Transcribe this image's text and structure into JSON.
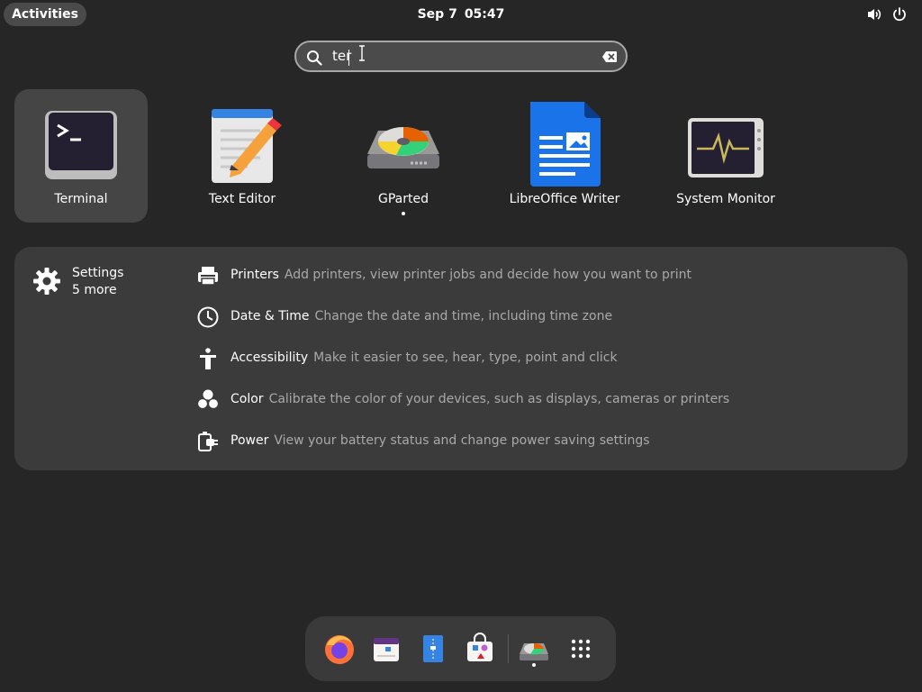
{
  "topbar": {
    "activities_label": "Activities",
    "date": "Sep 7",
    "time": "05:47"
  },
  "search": {
    "value": "ter"
  },
  "apps": [
    {
      "label": "Terminal",
      "icon": "terminal-icon",
      "selected": true
    },
    {
      "label": "Text Editor",
      "icon": "text-editor-icon"
    },
    {
      "label": "GParted",
      "icon": "gparted-icon",
      "running": true
    },
    {
      "label": "LibreOffice Writer",
      "icon": "libreoffice-writer-icon"
    },
    {
      "label": "System Monitor",
      "icon": "system-monitor-icon"
    }
  ],
  "settings_provider": {
    "name": "Settings",
    "more": "5 more",
    "icon": "gear-icon",
    "results": [
      {
        "title": "Printers",
        "desc": "Add printers, view printer jobs and decide how you want to print",
        "icon": "printer-icon"
      },
      {
        "title": "Date & Time",
        "desc": "Change the date and time, including time zone",
        "icon": "clock-icon"
      },
      {
        "title": "Accessibility",
        "desc": "Make it easier to see, hear, type, point and click",
        "icon": "accessibility-icon"
      },
      {
        "title": "Color",
        "desc": "Calibrate the color of your devices, such as displays, cameras or printers",
        "icon": "color-icon"
      },
      {
        "title": "Power",
        "desc": "View your battery status and change power saving settings",
        "icon": "power-plug-icon"
      }
    ]
  },
  "dash": {
    "items": [
      "firefox-icon",
      "calendar-icon",
      "files-icon",
      "software-icon",
      "gparted-icon",
      "show-apps-grid-icon"
    ]
  },
  "colors": {
    "background": "#262626",
    "panel": "#3b3b3b",
    "selected": "#454545",
    "writer_blue": "#1a73e8"
  }
}
